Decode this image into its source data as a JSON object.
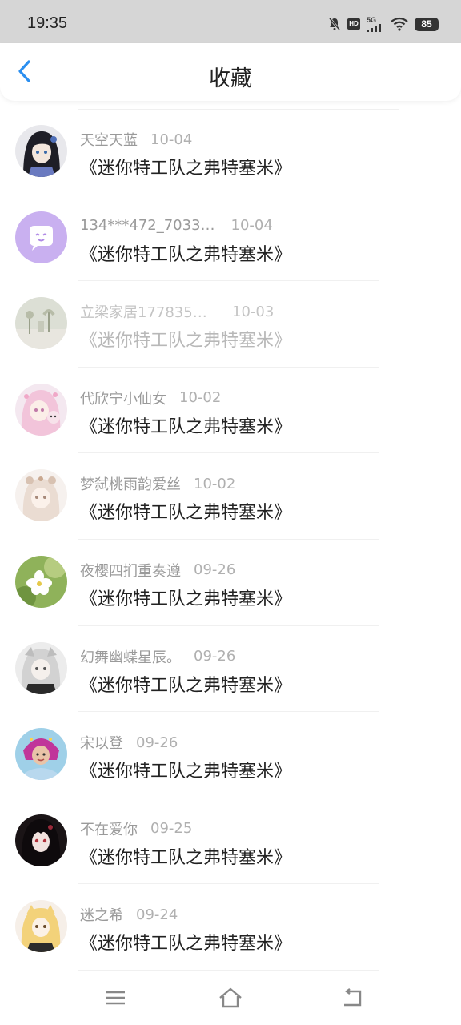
{
  "status_bar": {
    "time": "19:35",
    "battery": "85",
    "hd": "HD",
    "network": "5G"
  },
  "header": {
    "title": "收藏"
  },
  "accent_color": "#2b8ff0",
  "items": [
    {
      "name": "天空天蓝",
      "date": "10-04",
      "title": "《迷你特工队之弗特塞米》"
    },
    {
      "name": "134***472_7033…",
      "date": "10-04",
      "title": "《迷你特工队之弗特塞米》"
    },
    {
      "name": "立梁家居1778352…",
      "date": "10-03",
      "title": "《迷你特工队之弗特塞米》"
    },
    {
      "name": "代欣宁小仙女",
      "date": "10-02",
      "title": "《迷你特工队之弗特塞米》"
    },
    {
      "name": "梦弑桃雨韵爱丝",
      "date": "10-02",
      "title": "《迷你特工队之弗特塞米》"
    },
    {
      "name": "夜樱四扪重奏遵",
      "date": "09-26",
      "title": "《迷你特工队之弗特塞米》"
    },
    {
      "name": "幻舞幽蝶星辰。",
      "date": "09-26",
      "title": "《迷你特工队之弗特塞米》"
    },
    {
      "name": "宋以登",
      "date": "09-26",
      "title": "《迷你特工队之弗特塞米》"
    },
    {
      "name": "不在爱你",
      "date": "09-25",
      "title": "《迷你特工队之弗特塞米》"
    },
    {
      "name": "迷之希",
      "date": "09-24",
      "title": "《迷你特工队之弗特塞米》"
    }
  ]
}
